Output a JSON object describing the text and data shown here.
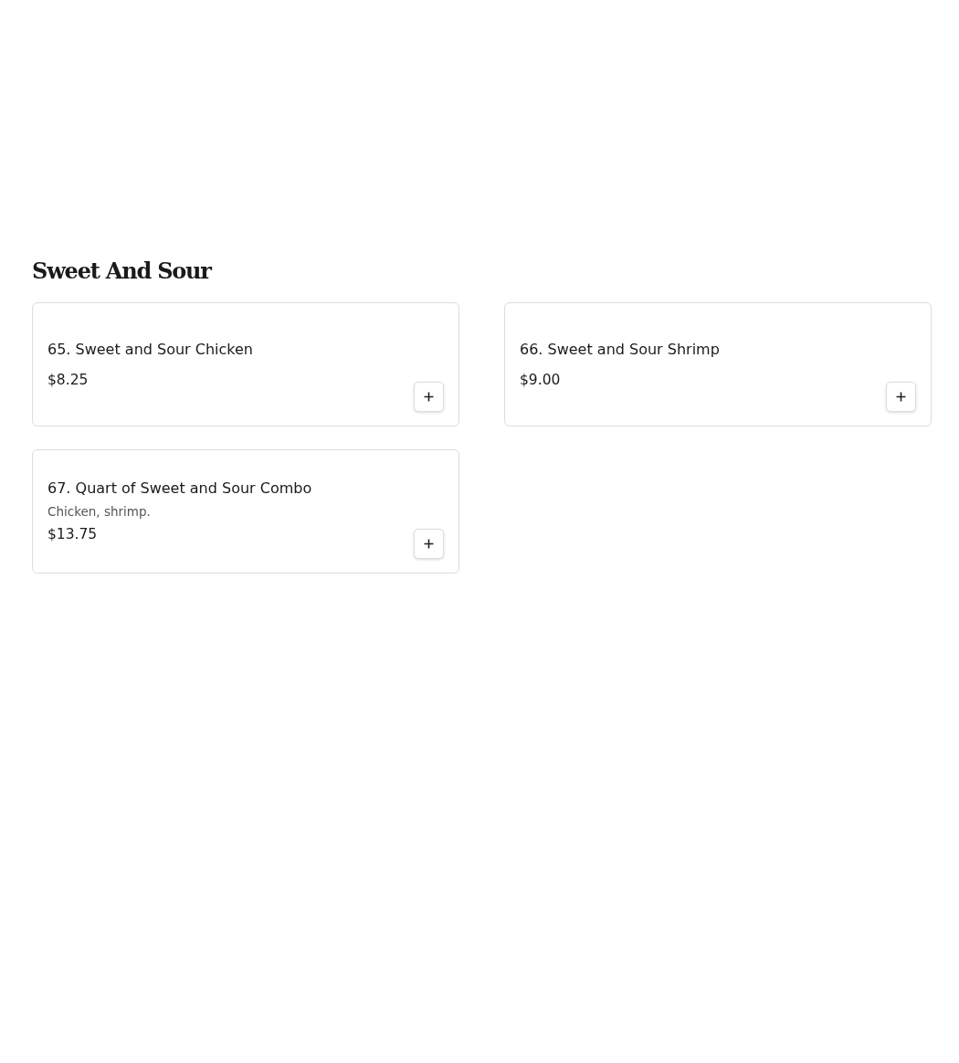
{
  "section": {
    "title": "Sweet And Sour",
    "items": [
      {
        "name": "65. Sweet and Sour Chicken",
        "price": "$8.25"
      },
      {
        "name": "66. Sweet and Sour Shrimp",
        "price": "$9.00"
      },
      {
        "name": "67. Quart of Sweet and Sour Combo",
        "description": "Chicken, shrimp.",
        "price": "$13.75"
      }
    ]
  }
}
